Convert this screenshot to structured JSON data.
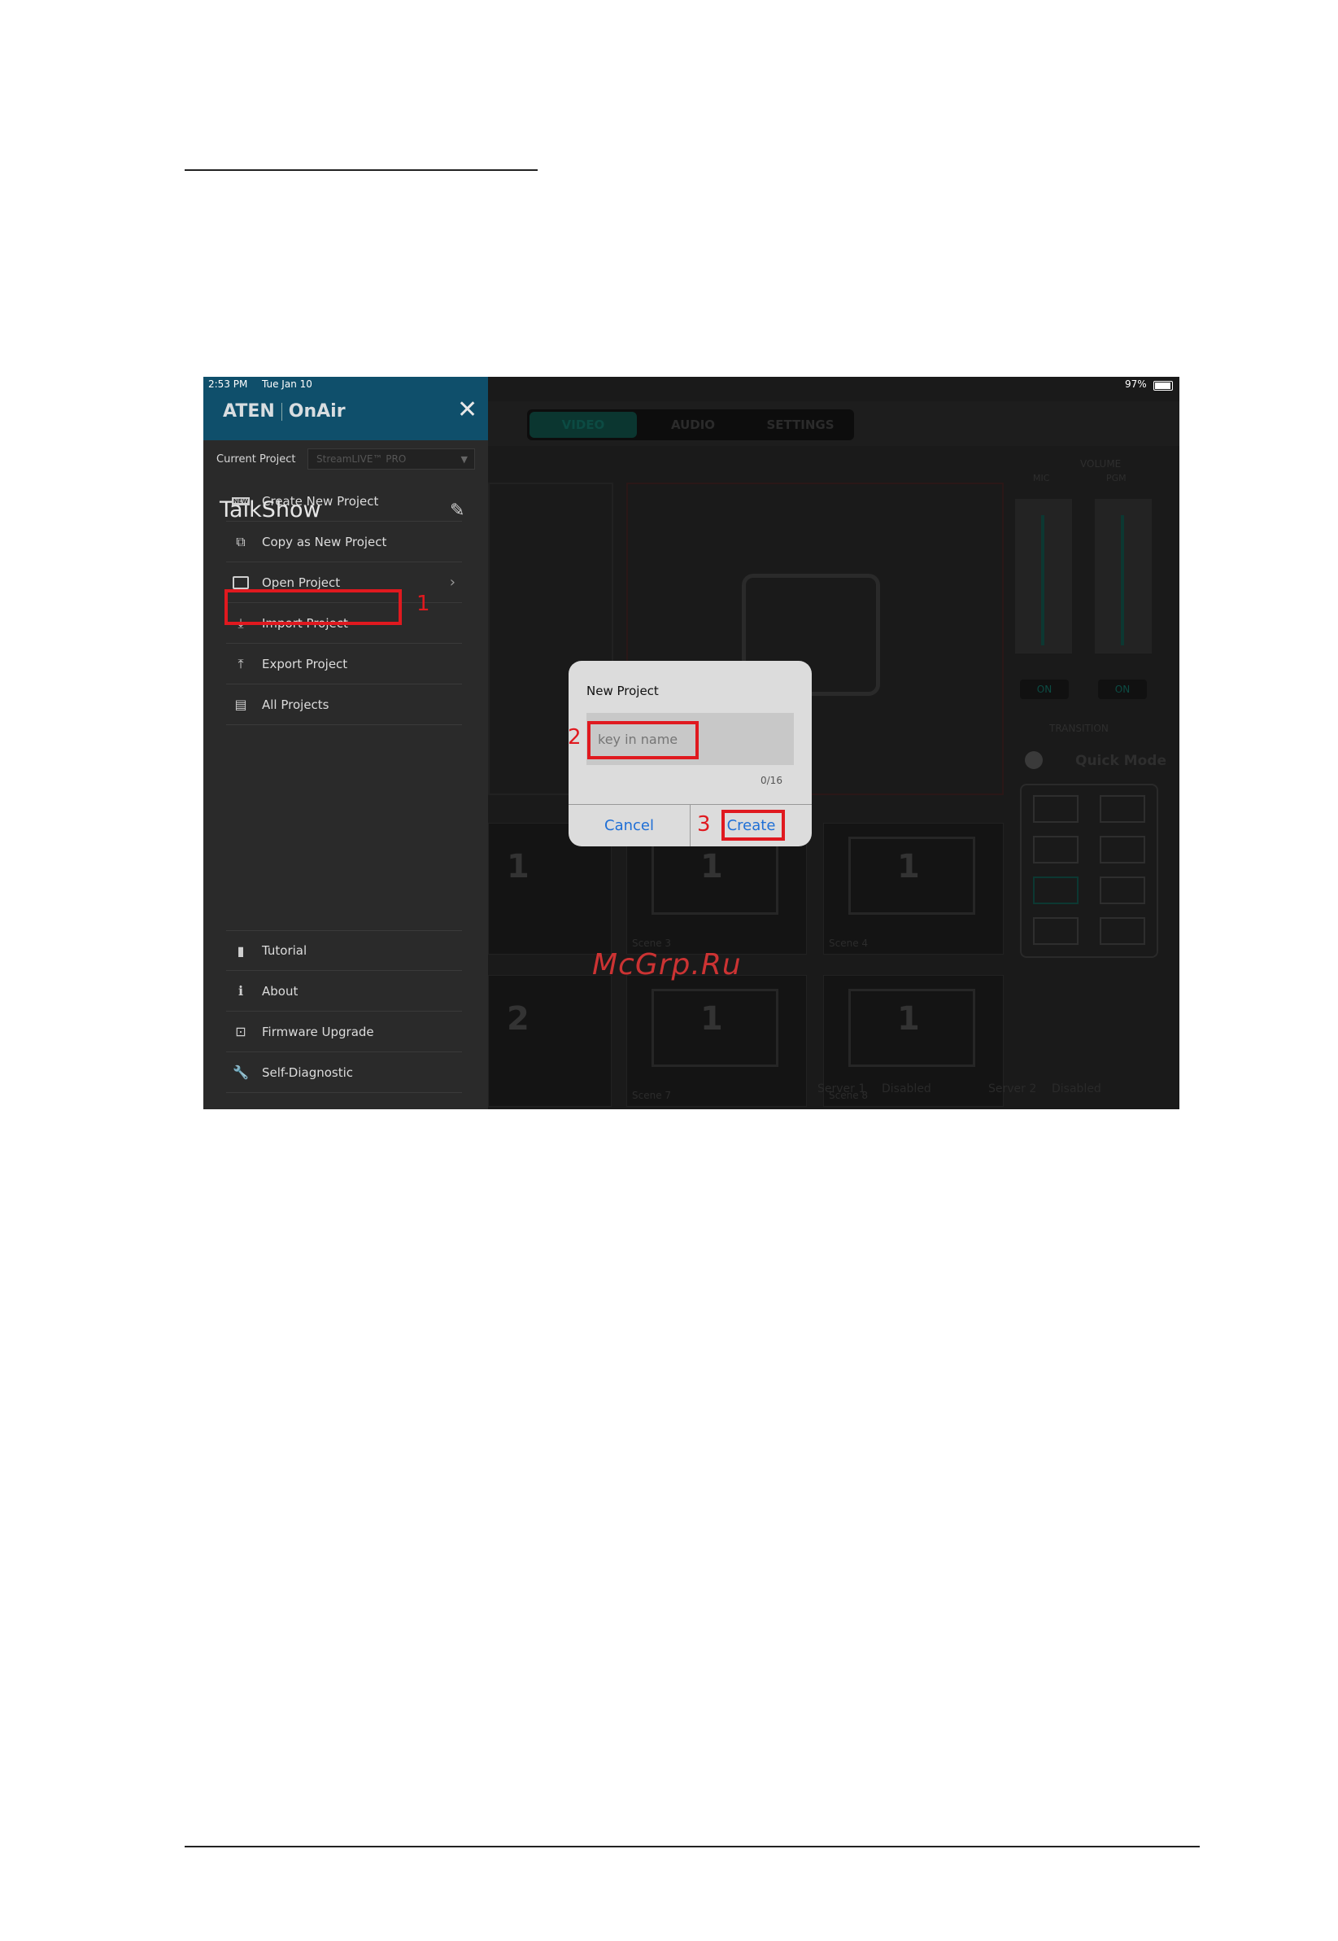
{
  "status_bar": {
    "time": "2:53 PM",
    "date": "Tue Jan 10",
    "battery": "97%"
  },
  "app": {
    "logo_brand": "ATEN",
    "logo_product": "OnAir",
    "close_icon": "close-icon",
    "current_project_label": "Current Project",
    "current_project_value": "StreamLIVE™ PRO",
    "project_name": "TalkShow"
  },
  "menu": {
    "items": [
      {
        "label": "Create New Project",
        "icon": "new-icon"
      },
      {
        "label": "Copy as New Project",
        "icon": "copy-icon"
      },
      {
        "label": "Open Project",
        "icon": "folder-icon"
      },
      {
        "label": "Import Project",
        "icon": "import-icon"
      },
      {
        "label": "Export Project",
        "icon": "export-icon"
      },
      {
        "label": "All Projects",
        "icon": "clipboard-icon"
      }
    ],
    "bottom_items": [
      {
        "label": "Tutorial",
        "icon": "book-icon"
      },
      {
        "label": "About",
        "icon": "info-icon"
      },
      {
        "label": "Firmware Upgrade",
        "icon": "firmware-icon"
      },
      {
        "label": "Self-Diagnostic",
        "icon": "wrench-icon"
      }
    ]
  },
  "background": {
    "tabs": [
      "VIDEO",
      "AUDIO",
      "SETTINGS"
    ],
    "volume_label": "VOLUME",
    "mic_label": "MIC",
    "pgm_label": "PGM",
    "on_label": "ON",
    "transition_label": "TRANSITION",
    "quick_mode": "Quick Mode",
    "scenes": [
      "Scene 3",
      "Scene 4",
      "Scene 7",
      "Scene 8"
    ],
    "servers": [
      "Server 1",
      "Disabled",
      "Server 2",
      "Disabled"
    ]
  },
  "dialog": {
    "title": "New Project",
    "placeholder": "key in name",
    "counter": "0/16",
    "cancel": "Cancel",
    "create": "Create"
  },
  "annotations": {
    "step1": "1",
    "step2": "2",
    "step3": "3"
  },
  "watermark": "McGrp.Ru",
  "colors": {
    "header_blue": "#0f4f6b",
    "highlight_red": "#e0191f",
    "dialog_button_blue": "#1f6fd6",
    "accent_teal": "#0c4b43"
  }
}
